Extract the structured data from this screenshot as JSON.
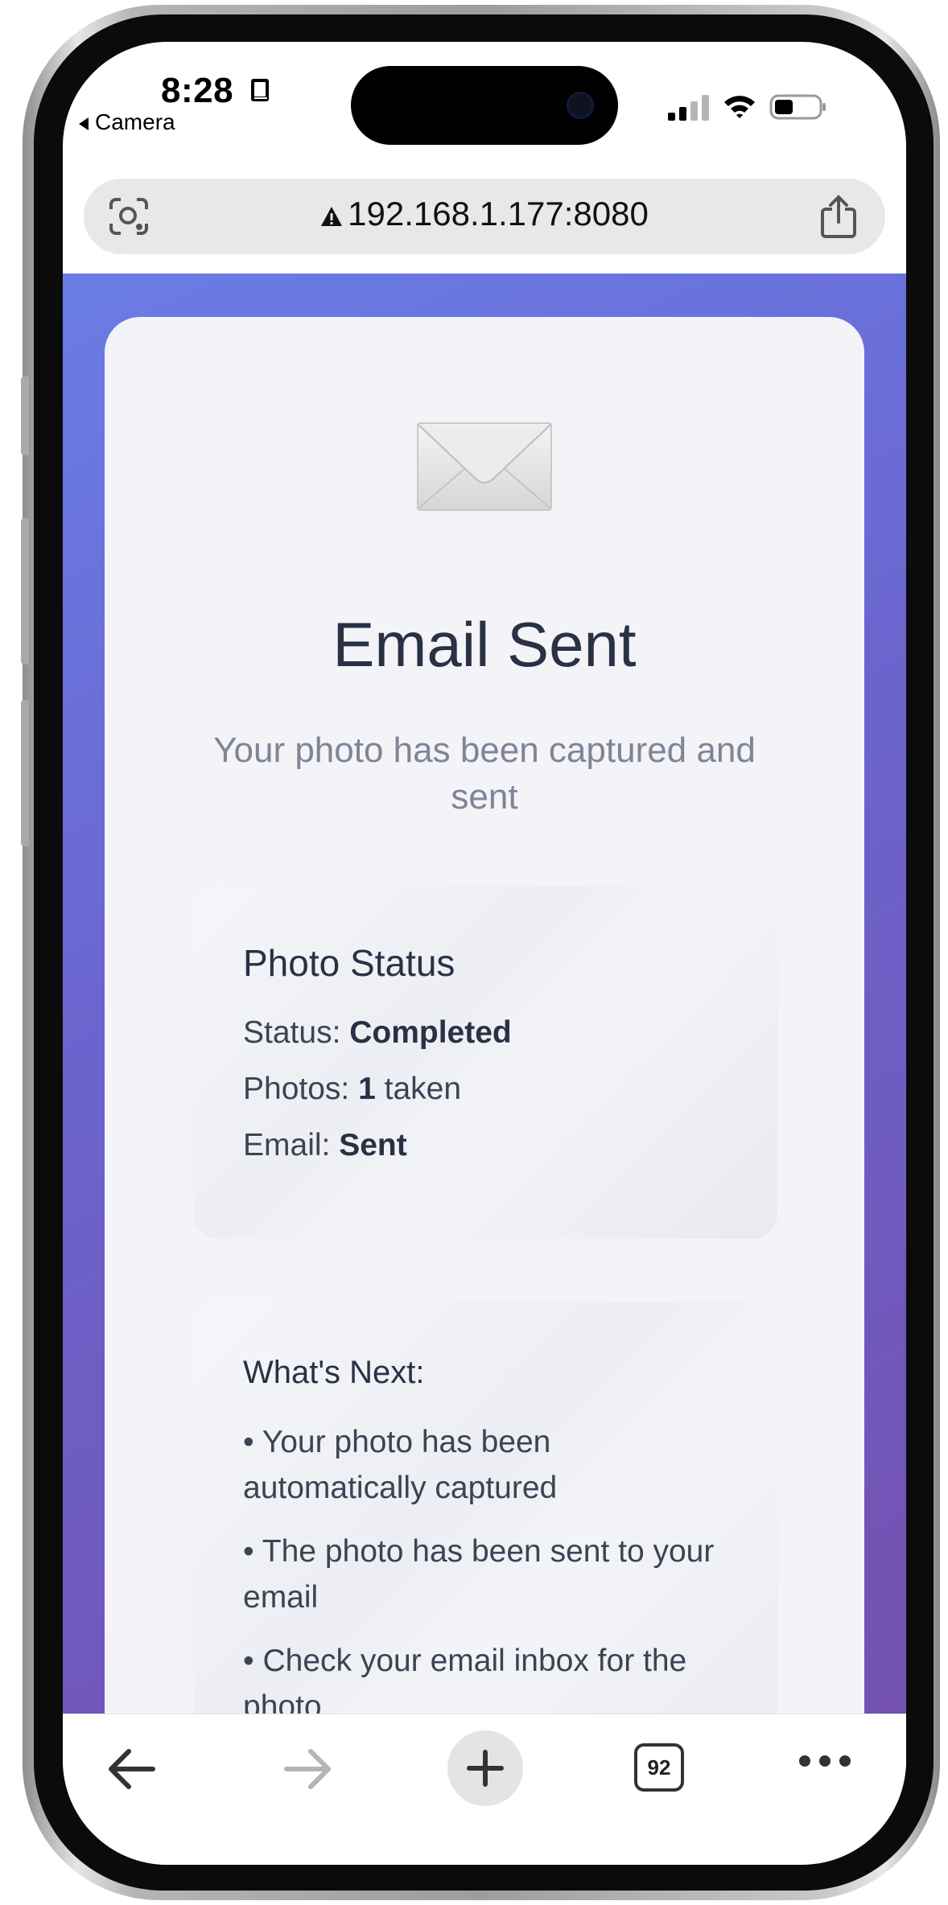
{
  "status_bar": {
    "time": "8:28",
    "back_app": "Camera",
    "icons": [
      "book-icon",
      "signal-icon",
      "wifi-icon",
      "battery-icon"
    ]
  },
  "url_bar": {
    "url": "192.168.1.177:8080",
    "icons": [
      "lens-icon",
      "not-secure-warning-icon",
      "share-icon"
    ]
  },
  "page": {
    "icon": "envelope-icon",
    "title": "Email Sent",
    "subtitle": "Your photo has been captured and sent",
    "status_box": {
      "title": "Photo Status",
      "rows": [
        {
          "label": "Status: ",
          "value": "Completed",
          "suffix": ""
        },
        {
          "label": "Photos: ",
          "value": "1",
          "suffix": " taken"
        },
        {
          "label": "Email: ",
          "value": "Sent",
          "suffix": ""
        }
      ]
    },
    "next_box": {
      "title": "What's Next:",
      "items": [
        "• Your photo has been automatically captured",
        "• The photo has been sent to your email",
        "• Check your email inbox for the photo"
      ]
    },
    "colors": {
      "gradient_start": "#6a7de6",
      "gradient_end": "#7451b0",
      "title": "#2a3145",
      "subtitle": "#7d8596"
    }
  },
  "toolbar": {
    "tab_count": "92",
    "icons": [
      "back-arrow-icon",
      "forward-arrow-icon",
      "new-tab-plus-icon",
      "tabs-icon",
      "more-icon"
    ]
  }
}
